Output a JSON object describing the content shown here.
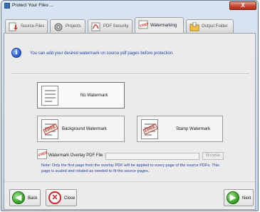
{
  "window": {
    "title": "Protect Your Files ...",
    "close_glyph": "X"
  },
  "tabs": [
    {
      "label": "Source Files",
      "icon": "source-files-icon",
      "active": false
    },
    {
      "label": "Projects",
      "icon": "projects-icon",
      "active": false
    },
    {
      "label": "PDF Security",
      "icon": "pdf-security-icon",
      "active": false
    },
    {
      "label": "Watermarking",
      "icon": "watermarking-icon",
      "active": true
    },
    {
      "label": "Output Folder",
      "icon": "output-folder-icon",
      "active": false
    }
  ],
  "info": {
    "glyph": "i",
    "text": "You can add your desired watermark on source pdf pages before protection."
  },
  "options": {
    "no_watermark": "No Watermark",
    "background_watermark": "Background Watermark",
    "stamp_watermark": "Stamp Watermark",
    "mark_text": "FREE"
  },
  "overlay": {
    "label": "Watermark Overlay PDF File :",
    "value": "",
    "browse_label": "Browse",
    "icon_text": "FREE"
  },
  "note": "Note: Only the first page from the overlay PDF will be applied to every page of the source PDFs. This page is scaled and rotated as needed to fit the source pages.",
  "footer": {
    "back_label": "Back",
    "close_label": "Close",
    "next_label": "Next"
  },
  "colors": {
    "info_text": "#1c3fae",
    "accent_green": "#2e9a1c",
    "close_red": "#d0242b"
  }
}
